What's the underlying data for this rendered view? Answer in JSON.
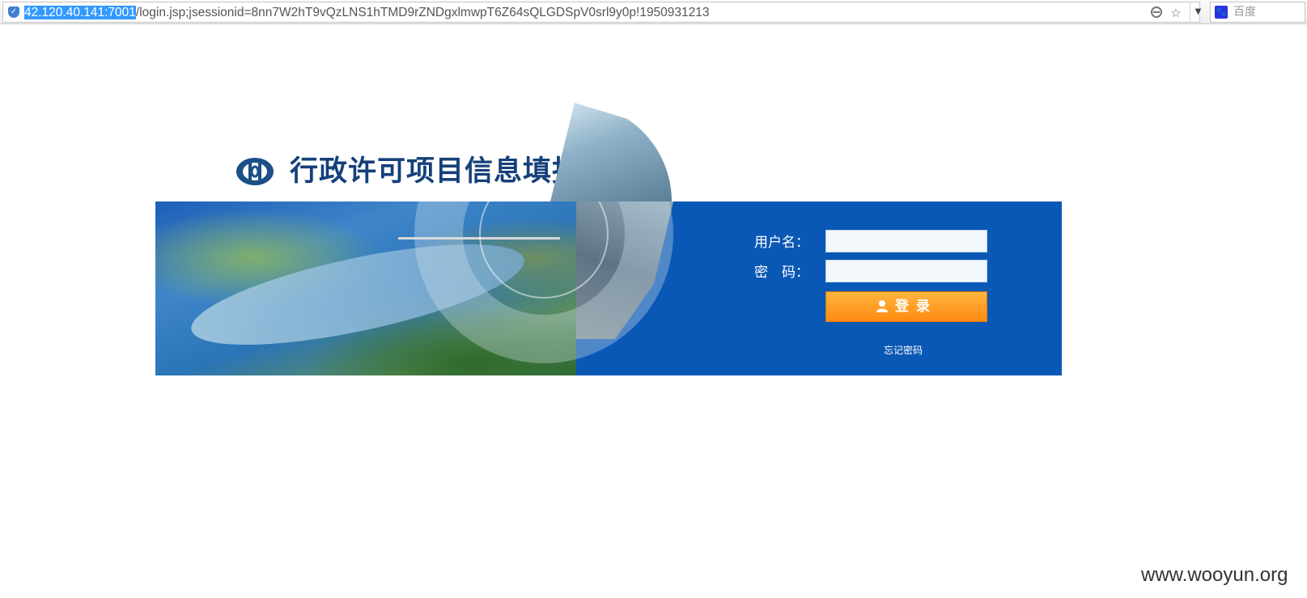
{
  "browser": {
    "url_host": "42.120.40.141:7001",
    "url_path": "/login.jsp;jsessionid=8nn7W2hT9vQzLNS1hTMD9rZNDgxlmwpT6Z64sQLGDSpV0srl9y0p!1950931213",
    "search_placeholder": "百度",
    "icons": [
      "shield-icon",
      "compat-mode-icon",
      "star-icon",
      "dropdown-icon",
      "baidu-icon"
    ]
  },
  "login": {
    "title": "行政许可项目信息填报表",
    "username_label": "用户名：",
    "password_label": "密　码：",
    "username_value": "",
    "password_value": "",
    "login_button": "登录",
    "forgot_password": "忘记密码"
  },
  "watermark": "www.wooyun.org",
  "colors": {
    "banner_blue": "#0a58b6",
    "title_navy": "#15407a",
    "button_orange": "#ff8a12"
  }
}
